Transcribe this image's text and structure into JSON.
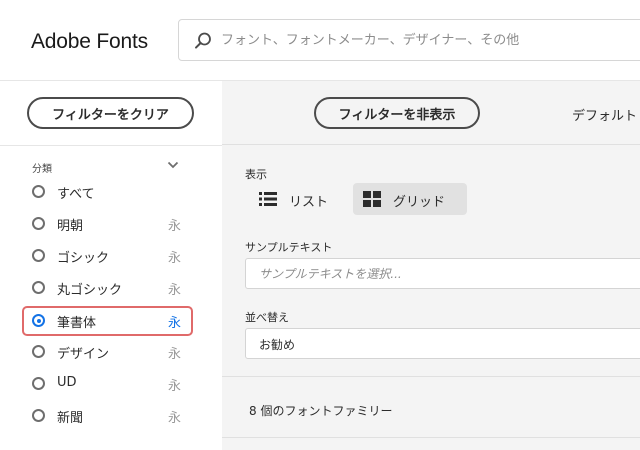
{
  "header": {
    "logo": "Adobe Fonts",
    "search_placeholder": "フォント、フォントメーカー、デザイナー、その他"
  },
  "sidebar": {
    "clear_filters_label": "フィルターをクリア",
    "section_label": "分類",
    "categories": [
      {
        "label": "すべて",
        "glyph": "",
        "selected": false
      },
      {
        "label": "明朝",
        "glyph": "永",
        "selected": false
      },
      {
        "label": "ゴシック",
        "glyph": "永",
        "selected": false
      },
      {
        "label": "丸ゴシック",
        "glyph": "永",
        "selected": false
      },
      {
        "label": "筆書体",
        "glyph": "永",
        "selected": true
      },
      {
        "label": "デザイン",
        "glyph": "永",
        "selected": false
      },
      {
        "label": "UD",
        "glyph": "永",
        "selected": false
      },
      {
        "label": "新聞",
        "glyph": "永",
        "selected": false
      }
    ]
  },
  "main": {
    "hide_filters_label": "フィルターを非表示",
    "sort_default_label": "デフォルト",
    "display_label": "表示",
    "view_list_label": "リスト",
    "view_grid_label": "グリッド",
    "sample_text_label": "サンプルテキスト",
    "sample_text_placeholder": "サンプルテキストを選択...",
    "sort_label": "並べ替え",
    "sort_value": "お勧め",
    "family_count": "8 個のフォントファミリー"
  },
  "colors": {
    "accent": "#1473e6",
    "highlight_border": "#e06a6a"
  }
}
